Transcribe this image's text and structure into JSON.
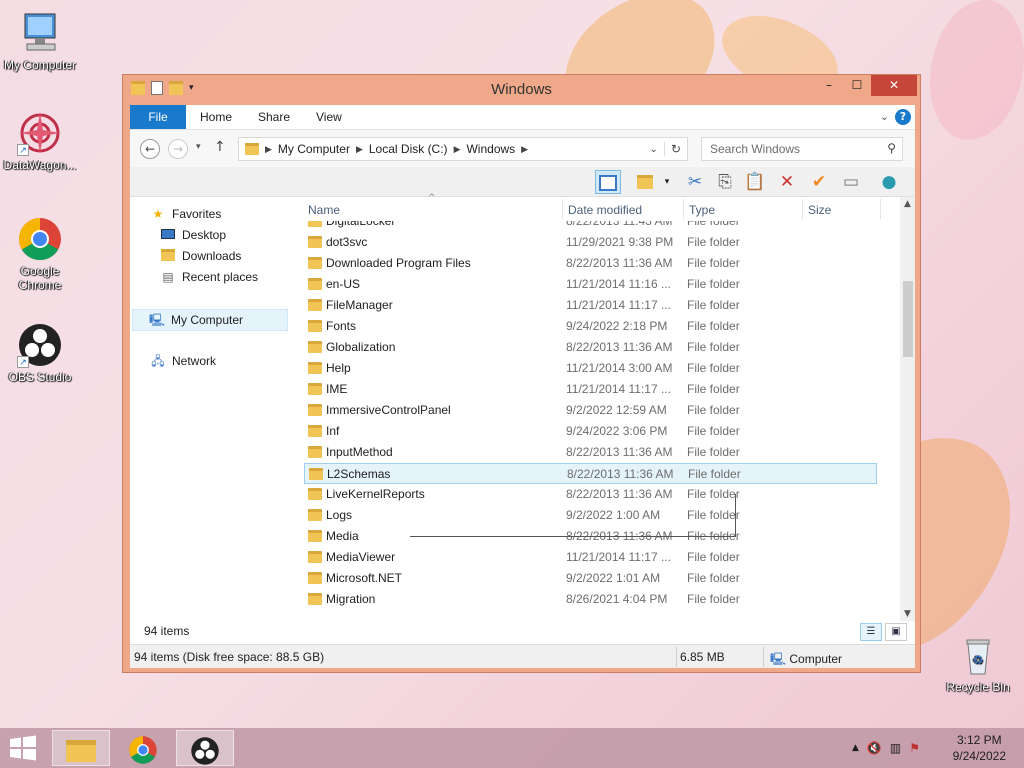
{
  "desktop": {
    "icons": [
      {
        "label": "My Computer",
        "icon": "computer-icon"
      },
      {
        "label": "DataWagon...",
        "icon": "datawagon-icon"
      },
      {
        "label": "Google Chrome",
        "icon": "chrome-icon"
      },
      {
        "label": "OBS Studio",
        "icon": "obs-icon"
      },
      {
        "label": "Recycle Bin",
        "icon": "recycle-bin-icon"
      }
    ]
  },
  "window": {
    "title": "Windows",
    "controls": {
      "minimize": "–",
      "maximize": "☐",
      "close": "✕"
    },
    "ribbon": {
      "file": "File",
      "home": "Home",
      "share": "Share",
      "view": "View",
      "help": "?"
    },
    "address": {
      "crumbs": [
        "My Computer",
        "Local Disk (C:)",
        "Windows"
      ]
    },
    "search": {
      "placeholder": "Search Windows"
    },
    "nav": {
      "favorites": "Favorites",
      "desktop": "Desktop",
      "downloads": "Downloads",
      "recent": "Recent places",
      "my_computer": "My Computer",
      "network": "Network"
    },
    "columns": {
      "name": "Name",
      "date": "Date modified",
      "type": "Type",
      "size": "Size"
    },
    "files": [
      {
        "name": "DigitalLocker",
        "date": "8/22/2013 11:43 AM",
        "type": "File folder"
      },
      {
        "name": "dot3svc",
        "date": "11/29/2021 9:38 PM",
        "type": "File folder"
      },
      {
        "name": "Downloaded Program Files",
        "date": "8/22/2013 11:36 AM",
        "type": "File folder"
      },
      {
        "name": "en-US",
        "date": "11/21/2014 11:16 ...",
        "type": "File folder"
      },
      {
        "name": "FileManager",
        "date": "11/21/2014 11:17 ...",
        "type": "File folder"
      },
      {
        "name": "Fonts",
        "date": "9/24/2022 2:18 PM",
        "type": "File folder"
      },
      {
        "name": "Globalization",
        "date": "8/22/2013 11:36 AM",
        "type": "File folder"
      },
      {
        "name": "Help",
        "date": "11/21/2014 3:00 AM",
        "type": "File folder"
      },
      {
        "name": "IME",
        "date": "11/21/2014 11:17 ...",
        "type": "File folder"
      },
      {
        "name": "ImmersiveControlPanel",
        "date": "9/2/2022 12:59 AM",
        "type": "File folder"
      },
      {
        "name": "Inf",
        "date": "9/24/2022 3:06 PM",
        "type": "File folder"
      },
      {
        "name": "InputMethod",
        "date": "8/22/2013 11:36 AM",
        "type": "File folder"
      },
      {
        "name": "L2Schemas",
        "date": "8/22/2013 11:36 AM",
        "type": "File folder"
      },
      {
        "name": "LiveKernelReports",
        "date": "8/22/2013 11:36 AM",
        "type": "File folder"
      },
      {
        "name": "Logs",
        "date": "9/2/2022 1:00 AM",
        "type": "File folder"
      },
      {
        "name": "Media",
        "date": "8/22/2013 11:36 AM",
        "type": "File folder"
      },
      {
        "name": "MediaViewer",
        "date": "11/21/2014 11:17 ...",
        "type": "File folder"
      },
      {
        "name": "Microsoft.NET",
        "date": "9/2/2022 1:01 AM",
        "type": "File folder"
      },
      {
        "name": "Migration",
        "date": "8/26/2021 4:04 PM",
        "type": "File folder"
      }
    ],
    "selected_file": "L2Schemas",
    "item_count": "94 items",
    "status": {
      "left": "94 items (Disk free space: 88.5 GB)",
      "size": "6.85 MB",
      "location": "Computer"
    }
  },
  "taskbar": {
    "apps": [
      "file-explorer-icon",
      "chrome-icon",
      "obs-icon"
    ],
    "time": "3:12 PM",
    "date": "9/24/2022"
  },
  "colors": {
    "accent": "#1979ca",
    "title_bar": "#f0a88a",
    "selection": "#e5f3fb",
    "close": "#c7463a"
  }
}
